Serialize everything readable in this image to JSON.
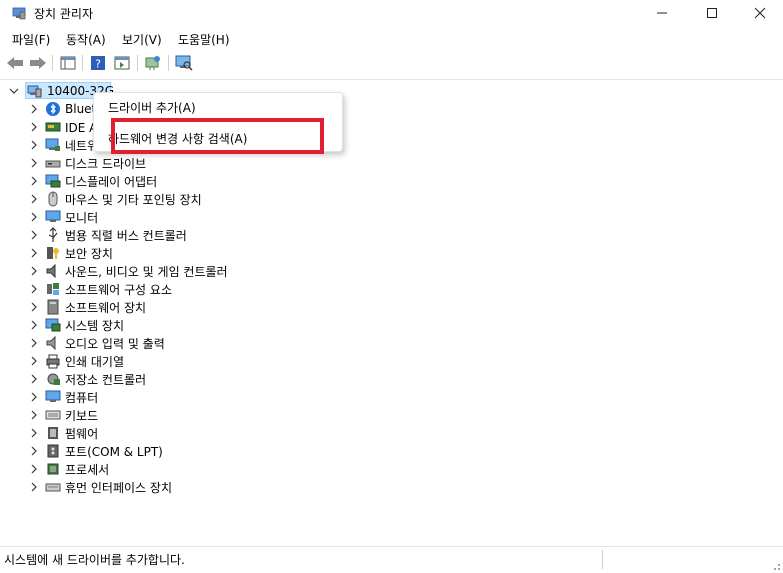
{
  "window": {
    "title": "장치 관리자",
    "minimize_icon": "minimize-icon",
    "maximize_icon": "maximize-icon",
    "close_icon": "close-icon"
  },
  "menu": [
    "파일(F)",
    "동작(A)",
    "보기(V)",
    "도움말(H)"
  ],
  "toolbar_icons": [
    "back-arrow-icon",
    "forward-arrow-icon",
    "properties-pane-icon",
    "help-icon",
    "show-hide-tree-icon",
    "update-driver-icon",
    "monitor-scan-icon"
  ],
  "tree": {
    "root": "10400-32G",
    "items": [
      {
        "label": "Bluetooth",
        "icon": "bluetooth-icon"
      },
      {
        "label": "IDE ATA/ATAPI 컨트롤러",
        "icon": "ide-controller-icon"
      },
      {
        "label": "네트워크 어댑터",
        "icon": "network-adapter-icon"
      },
      {
        "label": "디스크 드라이브",
        "icon": "disk-drive-icon"
      },
      {
        "label": "디스플레이 어댑터",
        "icon": "display-adapter-icon"
      },
      {
        "label": "마우스 및 기타 포인팅 장치",
        "icon": "mouse-icon"
      },
      {
        "label": "모니터",
        "icon": "monitor-icon"
      },
      {
        "label": "범용 직렬 버스 컨트롤러",
        "icon": "usb-icon"
      },
      {
        "label": "보안 장치",
        "icon": "security-device-icon"
      },
      {
        "label": "사운드, 비디오 및 게임 컨트롤러",
        "icon": "sound-icon"
      },
      {
        "label": "소프트웨어 구성 요소",
        "icon": "software-component-icon"
      },
      {
        "label": "소프트웨어 장치",
        "icon": "software-device-icon"
      },
      {
        "label": "시스템 장치",
        "icon": "system-device-icon"
      },
      {
        "label": "오디오 입력 및 출력",
        "icon": "audio-io-icon"
      },
      {
        "label": "인쇄 대기열",
        "icon": "printer-icon"
      },
      {
        "label": "저장소 컨트롤러",
        "icon": "storage-controller-icon"
      },
      {
        "label": "컴퓨터",
        "icon": "computer-icon"
      },
      {
        "label": "키보드",
        "icon": "keyboard-icon"
      },
      {
        "label": "펌웨어",
        "icon": "firmware-icon"
      },
      {
        "label": "포트(COM & LPT)",
        "icon": "port-icon"
      },
      {
        "label": "프로세서",
        "icon": "processor-icon"
      },
      {
        "label": "휴먼 인터페이스 장치",
        "icon": "hid-icon"
      }
    ]
  },
  "context_menu": {
    "item1": "드라이버 추가(A)",
    "item2": "하드웨어 변경 사항 검색(A)"
  },
  "status": "시스템에 새 드라이버를 추가합니다."
}
